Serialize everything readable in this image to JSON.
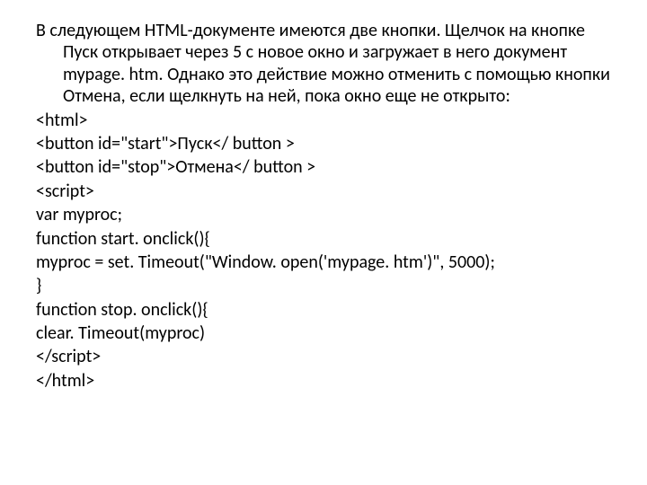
{
  "intro": "В следующем HTML-документе имеются две кнопки. Щелчок на кнопке Пуск открывает через 5 с новое окно и загружает в него документ mypage. htm. Однако это действие можно отменить с помощью кнопки Отмена, если щелкнуть на ней, пока окно еще не открыто:",
  "code": {
    "l1": "<html>",
    "l2": "<button id=\"start\">Пуск</ button >",
    "l3": "<button id=\"stop\">Отмена</ button >",
    "l4": "<script>",
    "l5": "var myproc;",
    "l6": "function start. onclick(){",
    "l7": "myproc = set. Timeout(\"Window. open('mypage. htm')\", 5000);",
    "l8": "}",
    "l9": "function stop. onclick(){",
    "l10": "clear. Timeout(myproc)",
    "l11": "</script>",
    "l12": "</html>"
  }
}
